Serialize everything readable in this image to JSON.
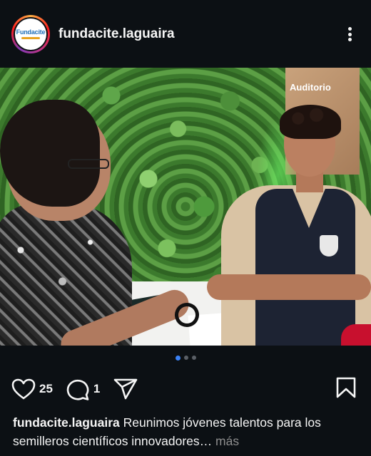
{
  "post": {
    "username": "fundacite.laguaira",
    "avatar_text": "Fundacite",
    "photo_sign_text": "Auditorio"
  },
  "actions": {
    "likes": "25",
    "comments": "1"
  },
  "carousel": {
    "count": 3,
    "active_index": 0
  },
  "caption": {
    "username": "fundacite.laguaira",
    "text": "Reunimos jóvenes talentos para los semilleros científicos innovadores",
    "ellipsis": "…",
    "more_label": "más"
  },
  "icons": {
    "more": "more-options-icon",
    "like": "heart-icon",
    "comment": "comment-icon",
    "share": "share-icon",
    "save": "bookmark-icon"
  },
  "colors": {
    "background": "#0c1014",
    "text": "#f5f5f5",
    "active_dot": "#3b82f6",
    "muted": "#8e8e8e"
  }
}
